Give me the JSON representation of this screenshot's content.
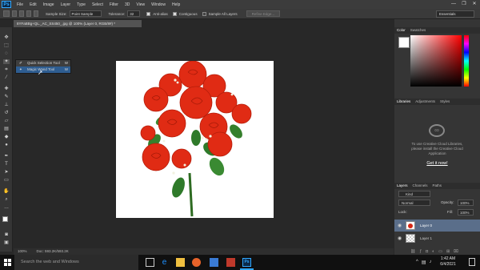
{
  "app": {
    "logo": "Ps"
  },
  "menu": [
    "File",
    "Edit",
    "Image",
    "Layer",
    "Type",
    "Select",
    "Filter",
    "3D",
    "View",
    "Window",
    "Help"
  ],
  "window_controls": [
    "—",
    "❐",
    "✕"
  ],
  "options": {
    "sample_size_label": "Sample Size:",
    "sample_size_value": "Point Sample",
    "tolerance_label": "Tolerance:",
    "tolerance_value": "32",
    "antialias_label": "Anti-alias",
    "contiguous_label": "Contiguous",
    "sample_all_label": "Sample All Layers",
    "refine_edge_label": "Refine Edge...",
    "workspace_value": "Essentials"
  },
  "document": {
    "tab_title": "8YFaBBg+QL._AC_SS450_.jpg @ 100% (Layer 0, RGB/8#) *",
    "zoom": "100%",
    "doc_info": "Doc: 593.2K/593.2K"
  },
  "flyout": {
    "items": [
      {
        "label": "Quick Selection Tool",
        "shortcut": "W"
      },
      {
        "label": "Magic Wand Tool",
        "shortcut": "W"
      }
    ]
  },
  "color_panel": {
    "tabs": [
      "Color",
      "Swatches"
    ]
  },
  "libraries_panel": {
    "tabs": [
      "Libraries",
      "Adjustments",
      "Styles"
    ],
    "message": [
      "To use Creative Cloud Libraries,",
      "please install the Creative Cloud",
      "Application"
    ],
    "cta": "Get it now!"
  },
  "layers_panel": {
    "tabs": [
      "Layers",
      "Channels",
      "Paths"
    ],
    "kind_label": "Kind",
    "blend_mode": "Normal",
    "opacity_label": "Opacity:",
    "opacity_value": "100%",
    "lock_label": "Lock:",
    "fill_label": "Fill:",
    "fill_value": "100%",
    "layers": [
      {
        "name": "Layer 0",
        "selected": true
      },
      {
        "name": "Layer 1",
        "selected": false
      }
    ]
  },
  "taskbar": {
    "search_placeholder": "Search the web and Windows",
    "time": "1:42 AM",
    "date": "6/4/2021"
  },
  "colors": {
    "accent": "#31a8ff",
    "selection": "#2e5d91",
    "bg": "#282828"
  }
}
